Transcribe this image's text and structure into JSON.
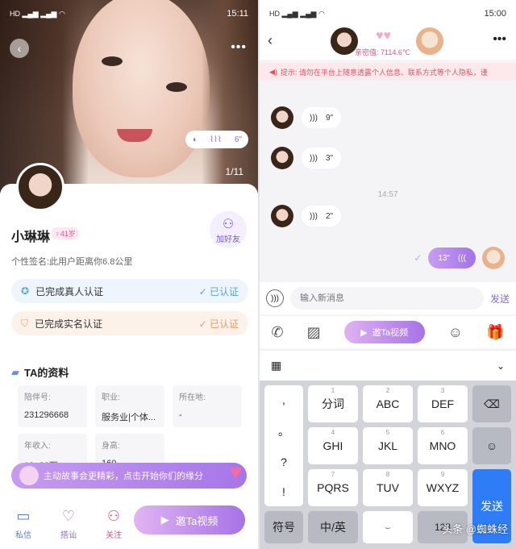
{
  "left": {
    "status": {
      "time": "15:11"
    },
    "hero": {
      "page_indicator": "1/11",
      "voice_duration": "6\""
    },
    "profile": {
      "name": "小琳琳",
      "age_badge": "♀41岁",
      "add_friend": "加好友",
      "signature": "个性签名:此用户距离你6.8公里"
    },
    "certs": [
      {
        "label": "已完成真人认证",
        "status": "✓ 已认证"
      },
      {
        "label": "已完成实名认证",
        "status": "✓ 已认证"
      }
    ],
    "section_title": "TA的资料",
    "info": [
      {
        "label": "陪伴号:",
        "value": "231296668"
      },
      {
        "label": "职业:",
        "value": "服务业|个体..."
      },
      {
        "label": "所在地:",
        "value": "-"
      },
      {
        "label": "年收入:",
        "value": "10~20万"
      },
      {
        "label": "身高:",
        "value": "160"
      }
    ],
    "story_banner": "主动故事会更精彩，点击开始你们的缘分",
    "nav": [
      {
        "label": "私信",
        "icon": "message-icon"
      },
      {
        "label": "搭讪",
        "icon": "heart-icon"
      },
      {
        "label": "关注",
        "icon": "follow-icon"
      }
    ],
    "video_button": "邀Ta视频"
  },
  "right": {
    "status": {
      "time": "15:00"
    },
    "intimacy": "亲密值: 7114.6℃",
    "notice": "提示: 请勿在平台上随意透露个人信息、联系方式等个人隐私，谨",
    "messages": [
      {
        "duration": "9\""
      },
      {
        "duration": "3\""
      },
      {
        "duration": "2\""
      }
    ],
    "timestamp": "14:57",
    "out_message": {
      "duration": "13\""
    },
    "input_placeholder": "输入新消息",
    "send_label": "发送",
    "tool_video": "邀Ta视频",
    "keyboard": {
      "left_col": [
        ",",
        "。",
        "?",
        "!"
      ],
      "keys": [
        {
          "main": "分词",
          "n": "1"
        },
        {
          "main": "ABC",
          "n": "2"
        },
        {
          "main": "DEF",
          "n": "3"
        },
        {
          "main": "GHI",
          "n": "4"
        },
        {
          "main": "JKL",
          "n": "5"
        },
        {
          "main": "MNO",
          "n": "6"
        },
        {
          "main": "PQRS",
          "n": "7"
        },
        {
          "main": "TUV",
          "n": "8"
        },
        {
          "main": "WXYZ",
          "n": "9"
        }
      ],
      "symbol": "符号",
      "lang": "中/英",
      "send": "发送"
    },
    "watermark": "头条 @蜘蛛经"
  }
}
